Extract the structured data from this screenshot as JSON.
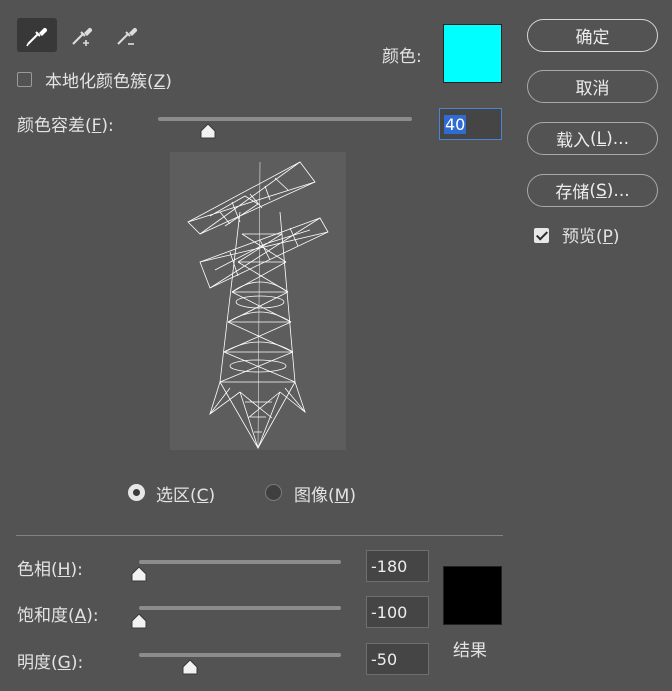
{
  "tools": [
    {
      "name": "eyedropper",
      "active": true
    },
    {
      "name": "eyedropper-add"
    },
    {
      "name": "eyedropper-subtract"
    }
  ],
  "localized": {
    "label": "本地化颜色簇",
    "key": "Z",
    "checked": false
  },
  "color": {
    "label": "颜色:",
    "swatch": "#00ffff"
  },
  "fuzziness": {
    "label": "颜色容差",
    "key": "F",
    "value": "40",
    "value_percent": 20
  },
  "mode": {
    "selection": {
      "label": "选区",
      "key": "C",
      "selected": true
    },
    "image": {
      "label": "图像",
      "key": "M",
      "selected": false
    }
  },
  "buttons": {
    "ok": "确定",
    "cancel": "取消",
    "load": {
      "label": "载入",
      "key": "L",
      "suffix": "..."
    },
    "save": {
      "label": "存储",
      "key": "S",
      "suffix": "..."
    }
  },
  "preview_option": {
    "label": "预览",
    "key": "P",
    "checked": true
  },
  "adjust": {
    "hue": {
      "label": "色相",
      "key": "H",
      "value": "-180",
      "value_percent": 0
    },
    "saturation": {
      "label": "饱和度",
      "key": "A",
      "value": "-100",
      "value_percent": 0
    },
    "lightness": {
      "label": "明度",
      "key": "G",
      "value": "-50",
      "value_percent": 25
    }
  },
  "result": {
    "label": "结果",
    "swatch": "#000000"
  },
  "punct": {
    "open": "(",
    "close": ")",
    "colon": "):"
  }
}
